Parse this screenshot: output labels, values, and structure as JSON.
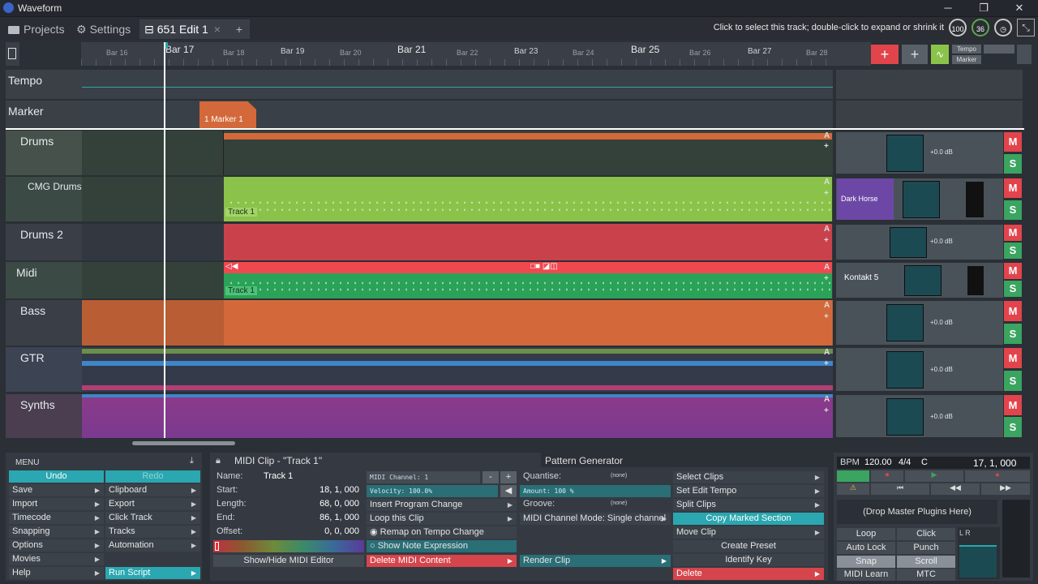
{
  "window": {
    "title": "Waveform",
    "minimize": "─",
    "maximize": "❐",
    "close": "✕"
  },
  "tabs": [
    {
      "label": "Projects"
    },
    {
      "label": "Settings"
    },
    {
      "label": "651 Edit 1",
      "close": "×"
    },
    {
      "label": "+"
    }
  ],
  "hint": "Click to select this track; double-click to expand or shrink it",
  "gauges": {
    "cpu": "100",
    "other": "36"
  },
  "ruler": {
    "bars": [
      {
        "label": "Bar 16",
        "big": false
      },
      {
        "label": "Bar 17",
        "big": true
      },
      {
        "label": "Bar 18",
        "big": false
      },
      {
        "label": "Bar 19",
        "big": false
      },
      {
        "label": "Bar 20",
        "big": false
      },
      {
        "label": "Bar 21",
        "big": true
      },
      {
        "label": "Bar 22",
        "big": false
      },
      {
        "label": "Bar 23",
        "big": false
      },
      {
        "label": "Bar 24",
        "big": false
      },
      {
        "label": "Bar 25",
        "big": true
      },
      {
        "label": "Bar 26",
        "big": false
      },
      {
        "label": "Bar 27",
        "big": false
      },
      {
        "label": "Bar 28",
        "big": false
      }
    ],
    "add_track": "+",
    "tempo_label": "Tempo",
    "marker_label": "Marker"
  },
  "tracks": {
    "tempo": "Tempo",
    "marker": "Marker",
    "marker_clip": "1 Marker 1",
    "drums": {
      "name": "Drums",
      "db": "+0.0 dB"
    },
    "cmg": {
      "name": "CMG Drums",
      "plugin": "Dark Horse Visual",
      "clip": "Track 1"
    },
    "drums2": {
      "name": "Drums 2",
      "db": "+0.0 dB"
    },
    "midi": {
      "name": "Midi",
      "plugin": "Kontakt 5",
      "clip": "Track 1"
    },
    "bass": {
      "name": "Bass",
      "db": "+0.0 dB"
    },
    "gtr": {
      "name": "GTR",
      "db": "+0.0 dB"
    },
    "synths": {
      "name": "Synths",
      "db": "+0.0 dB"
    },
    "m": "M",
    "s": "S",
    "a": "A",
    "plus": "+"
  },
  "menu": {
    "title": "MENU",
    "undo": "Undo",
    "redo": "Redo",
    "left": [
      "Save",
      "Import",
      "Timecode",
      "Snapping",
      "Options",
      "Movies",
      "Help"
    ],
    "right": [
      "Clipboard",
      "Export",
      "Click Track",
      "Tracks",
      "Automation",
      "",
      "Run Script"
    ]
  },
  "clip_panel": {
    "title": "MIDI Clip - \"Track 1\"",
    "pattern_title": "Pattern Generator",
    "fields": [
      {
        "label": "Name:",
        "value": "Track 1"
      },
      {
        "label": "Start:",
        "value": "18, 1, 000"
      },
      {
        "label": "Length:",
        "value": "68, 0, 000"
      },
      {
        "label": "End:",
        "value": "86, 1, 000"
      },
      {
        "label": "Offset:",
        "value": "0, 0, 000"
      }
    ],
    "show_hide": "Show/Hide MIDI Editor",
    "midi_channel": "MIDI Channel: 1",
    "velocity": "Velocity: 100.0%",
    "insert_pc": "Insert Program Change",
    "loop_clip": "Loop this Clip",
    "remap": "Remap on Tempo Change",
    "show_note": "Show Note Expression",
    "delete_midi": "Delete MIDI Content",
    "quantise_label": "Quantise:",
    "quantise_val": "(none)",
    "amount": "Amount: 100 %",
    "groove_label": "Groove:",
    "groove_val": "(none)",
    "channel_mode": "MIDI Channel Mode: Single channel",
    "render": "Render Clip",
    "select_clips": "Select Clips",
    "set_edit_tempo": "Set Edit Tempo",
    "split_clips": "Split Clips",
    "copy_marked": "Copy Marked Section",
    "move_clip": "Move Clip",
    "create_preset": "Create Preset",
    "identify_key": "Identify Key",
    "delete": "Delete"
  },
  "transport": {
    "bpm_label": "BPM",
    "bpm": "120.00",
    "sig": "4/4",
    "key": "C",
    "position": "17, 1, 000",
    "master": "(Drop Master Plugins Here)",
    "loop": "Loop",
    "click": "Click",
    "autolock": "Auto Lock",
    "punch": "Punch",
    "snap": "Snap",
    "scroll": "Scroll",
    "midilearn": "MIDI Learn",
    "mtc": "MTC",
    "lr": "L R"
  },
  "colors": {
    "green": "#8bc34a",
    "red": "#c9424b",
    "orange": "#d3693a",
    "teal": "#2aa7b0",
    "purple": "#6d47a6",
    "midi_green": "#2aa257"
  }
}
